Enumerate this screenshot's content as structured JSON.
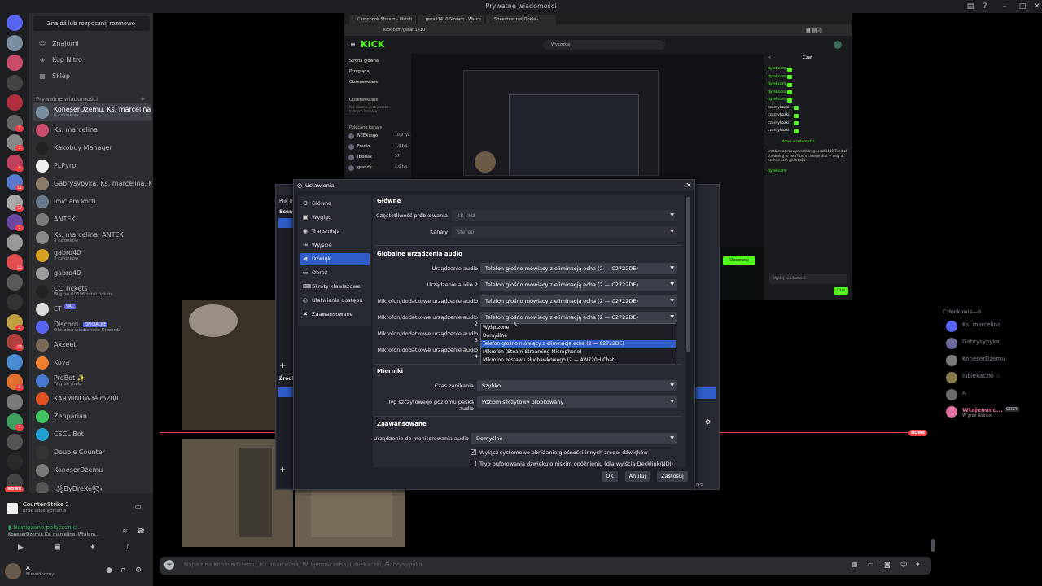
{
  "app": {
    "title": "Prywatne wiadomości"
  },
  "sidebar": {
    "search_placeholder": "Znajdź lub rozpocznij rozmowę",
    "nav": [
      {
        "label": "Znajomi",
        "icon": "friends-icon"
      },
      {
        "label": "Kup Nitro",
        "icon": "nitro-icon"
      },
      {
        "label": "Sklep",
        "icon": "shop-icon"
      }
    ],
    "dm_header": "Prywatne wiadomości",
    "add_dm": "+",
    "dms": [
      {
        "name": "KoneserDżemu, Ks. marcelina...",
        "sub": "6 członków",
        "color": "#7a8ea0"
      },
      {
        "name": "Ks. marcelina",
        "sub": "",
        "color": "#c94d6b"
      },
      {
        "name": "Kakobuy Manager",
        "sub": "",
        "color": "#222222"
      },
      {
        "name": "PLPyrpi",
        "sub": "",
        "color": "#eeeeee"
      },
      {
        "name": "Gabrysypyka, Ks. marcelina, K...",
        "sub": "",
        "color": "#8a7a6a"
      },
      {
        "name": "lovciam.kotti",
        "sub": "",
        "color": "#6a7a8a"
      },
      {
        "name": "ANTEK",
        "sub": "",
        "color": "#7a7a7a"
      },
      {
        "name": "Ks. marcelina, ANTEK",
        "sub": "3 członków",
        "color": "#8a8a8a"
      },
      {
        "name": "gabro40",
        "sub": "2 członków",
        "color": "#d8a020"
      },
      {
        "name": "gabro40",
        "sub": "",
        "color": "#9a9a9a"
      },
      {
        "name": "CC Tickets",
        "sub": "W grze 60696 total tickets",
        "color": "#222222"
      },
      {
        "name": "ET",
        "sub": "",
        "color": "#dddddd",
        "badge": "VAL"
      },
      {
        "name": "Discord",
        "sub": "Oficjalna wiadomość Discorda",
        "color": "#5865f2",
        "badge": "OFICJALNE"
      },
      {
        "name": "Axzeet",
        "sub": "",
        "color": "#7a6a5a"
      },
      {
        "name": "Koya",
        "sub": "",
        "color": "#f08030"
      },
      {
        "name": "ProBot ✨",
        "sub": "W grze /help",
        "color": "#4a7ad0"
      },
      {
        "name": "KARMINOWYaim200",
        "sub": "",
        "color": "#e05020"
      },
      {
        "name": "Zepparian",
        "sub": "",
        "color": "#40c060"
      },
      {
        "name": "CSCL Bot",
        "sub": "",
        "color": "#20a0d0"
      },
      {
        "name": "Double Counter",
        "sub": "",
        "color": "#333333"
      },
      {
        "name": "KoneserDżemu",
        "sub": "",
        "color": "#7a7a7a"
      },
      {
        "name": "꧁ByDreXe꧂",
        "sub": "",
        "color": "#555555"
      }
    ]
  },
  "user_area": {
    "activity_title": "Counter-Strike 2",
    "activity_sub": "Brak udostępniania",
    "voice_status": "Nawiązano połączenie",
    "voice_channel": "KoneserDżemu, Ks. marcelina, Wtajem...",
    "username": "A",
    "user_status": "Niewidoczny",
    "nowe_badge": "NOWE"
  },
  "browser": {
    "tabs": [
      "Campbook Stream - Watch ...",
      "geralt1410 Stream - Watch ...",
      "Speedtest.net Ookla - globalny ..."
    ],
    "url": "kick.com/geralt1410",
    "logo": "KICK",
    "search": "Wyszukaj",
    "nav": [
      "Strona główna",
      "Przeglądaj",
      "Obserwowane"
    ],
    "followed_header": "Obserwowane",
    "followed_note": "Nie obserwujesz jeszcze żadnych kanałów",
    "recommended_header": "Polecane kanały",
    "recommended": [
      {
        "name": "NEEXcsgo",
        "viewers": "10,3 tys."
      },
      {
        "name": "Franio",
        "viewers": "7,4 tys."
      },
      {
        "name": "Ibisdax",
        "viewers": "57"
      },
      {
        "name": "grandy",
        "viewers": "4,6 tys."
      }
    ],
    "chat_title": "Czat",
    "chat_lines": [
      "dyrekcom:",
      "dyrekcom:",
      "dyrekcom:",
      "dyrekcom:",
      "dyrekcom:",
      "czarnykozki:",
      "czarnykozki:",
      "czarnykozki:",
      "czarnykozki:"
    ],
    "new_messages": "Nowe wiadomości",
    "chat_msg": "kmeblerrogetlowymembik: @geralt1410 Tired of streaming to zero? Let's change that — only at nochrie.com @UcrlleDc",
    "chat_last": "dyrekcom:",
    "follow_btn": "Obserwuj",
    "send_placeholder": "Wyślij wiadomość",
    "chat_btn": "Czat"
  },
  "members": {
    "header": "Członkowie—6",
    "list": [
      {
        "name": "Ks. marcelina",
        "color": "#5865f2"
      },
      {
        "name": "Gabrysypyka",
        "color": "#6a6a9a"
      },
      {
        "name": "KoneserDżemu",
        "color": "#7a7a7a"
      },
      {
        "name": "lubiekaczki ☆",
        "color": "#8a7a4a"
      },
      {
        "name": "A",
        "color": "#6a6a6a"
      },
      {
        "name": "Wtajemnic...",
        "color": "#e070a0",
        "sub": "W grze Roblox",
        "badge": "COZY"
      }
    ]
  },
  "chat_input_placeholder": "Napisz na KoneserDżemu, Ks. marcelina, Wtajemniczona, lubiekaczki, Gabrysypyka",
  "obs_behind": {
    "menu": "Plik (F",
    "scenes": "Sceny",
    "sources": "Źródł",
    "fps": "FPS"
  },
  "settings": {
    "title": "Ustawienia",
    "sidebar": [
      {
        "label": "Główne",
        "icon": "gear-icon",
        "glyph": "⚙"
      },
      {
        "label": "Wygląd",
        "icon": "appearance-icon",
        "glyph": "▣"
      },
      {
        "label": "Transmisja",
        "icon": "stream-icon",
        "glyph": "◉"
      },
      {
        "label": "Wyjście",
        "icon": "output-icon",
        "glyph": "⇥"
      },
      {
        "label": "Dźwięk",
        "icon": "audio-icon",
        "glyph": "◀",
        "selected": true
      },
      {
        "label": "Obraz",
        "icon": "video-icon",
        "glyph": "▭"
      },
      {
        "label": "Skróty klawiszowe",
        "icon": "keyboard-icon",
        "glyph": "⌨"
      },
      {
        "label": "Ułatwienia dostępu",
        "icon": "accessibility-icon",
        "glyph": "◎"
      },
      {
        "label": "Zaawansowane",
        "icon": "wrench-icon",
        "glyph": "✖"
      }
    ],
    "general": {
      "header": "Główne",
      "sample_rate_label": "Częstotliwość próbkowania",
      "sample_rate_value": "48 kHz",
      "channels_label": "Kanały",
      "channels_value": "Stereo"
    },
    "global_audio": {
      "header": "Globalne urządzenia audio",
      "rows": [
        {
          "label": "Urządzenie audio",
          "value": "Telefon głośno mówiący z eliminacją echa (2 — C2722DE)"
        },
        {
          "label": "Urządzenie audio 2",
          "value": "Telefon głośno mówiący z eliminacją echa (2 — C2722DE)"
        },
        {
          "label": "Mikrofon/dodatkowe urządzenie audio",
          "value": "Telefon głośno mówiący z eliminacją echa (2 — C2722DE)"
        },
        {
          "label": "Mikrofon/dodatkowe urządzenie audio 2",
          "value": "Telefon głośno mówiący z eliminacją echa (2 — C2722DE)"
        },
        {
          "label": "Mikrofon/dodatkowe urządzenie audio 3",
          "value": ""
        },
        {
          "label": "Mikrofon/dodatkowe urządzenie audio 4",
          "value": ""
        }
      ]
    },
    "dropdown_options": [
      "Wyłączone",
      "Domyślne",
      "Telefon głośno mówiący z eliminacją echa (2 — C2722DE)",
      "Mikrofon (Steam Streaming Microphone)",
      "Mikrofon zestawu słuchawkowego (2 — AW720H Chat)"
    ],
    "dropdown_highlighted": 2,
    "meters": {
      "header": "Mierniki",
      "decay_label": "Czas zanikania",
      "decay_value": "Szybko",
      "peak_label": "Typ szczytowego poziomu paska audio",
      "peak_value": "Poziom szczytowy próbkowany"
    },
    "advanced": {
      "header": "Zaawansowane",
      "monitor_label": "Urządzenie do monitorowania audio",
      "monitor_value": "Domyślne",
      "check1": "Wyłącz systemowe obniżanie głośności innych źródeł dźwięków",
      "check1_checked": true,
      "check2": "Tryb buforowania dźwięku o niskim opóźnieniu (dla wyjścia Decklink/NDI)",
      "check2_checked": false
    },
    "buttons": {
      "ok": "OK",
      "cancel": "Anuluj",
      "apply": "Zastosuj"
    }
  }
}
